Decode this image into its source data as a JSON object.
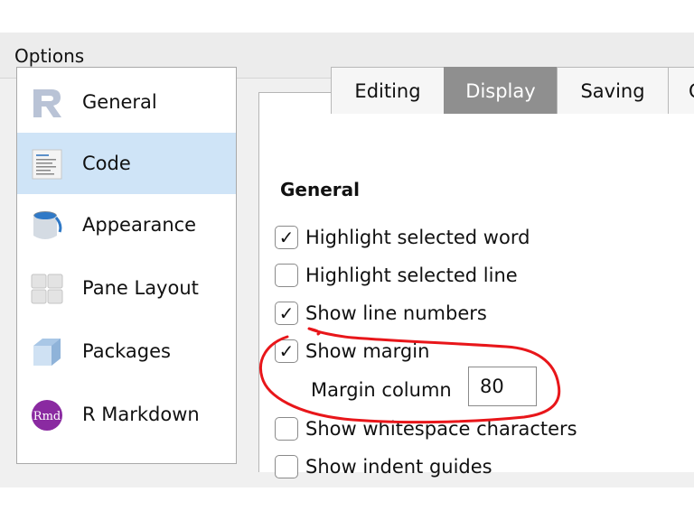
{
  "window": {
    "title": "Options"
  },
  "sidebar": {
    "items": [
      {
        "label": "General",
        "icon": "r-logo-icon",
        "selected": false
      },
      {
        "label": "Code",
        "icon": "code-document-icon",
        "selected": true
      },
      {
        "label": "Appearance",
        "icon": "paint-bucket-icon",
        "selected": false
      },
      {
        "label": "Pane Layout",
        "icon": "pane-layout-icon",
        "selected": false
      },
      {
        "label": "Packages",
        "icon": "package-box-icon",
        "selected": false
      },
      {
        "label": "R Markdown",
        "icon": "rmd-icon",
        "selected": false
      }
    ]
  },
  "tabs": [
    {
      "label": "Editing",
      "active": false
    },
    {
      "label": "Display",
      "active": true
    },
    {
      "label": "Saving",
      "active": false
    },
    {
      "label": "C",
      "active": false
    }
  ],
  "display": {
    "section_title": "General",
    "options": [
      {
        "label": "Highlight selected word",
        "checked": true
      },
      {
        "label": "Highlight selected line",
        "checked": false
      },
      {
        "label": "Show line numbers",
        "checked": true
      },
      {
        "label": "Show margin",
        "checked": true
      },
      {
        "label": "Show whitespace characters",
        "checked": false
      },
      {
        "label": "Show indent guides",
        "checked": false
      }
    ],
    "margin_column": {
      "label": "Margin column",
      "value": "80"
    },
    "check_mark": "✓"
  },
  "colors": {
    "selected_item": "#cfe4f7",
    "active_tab": "#8f8f8f",
    "annotation": "#e8161a"
  }
}
